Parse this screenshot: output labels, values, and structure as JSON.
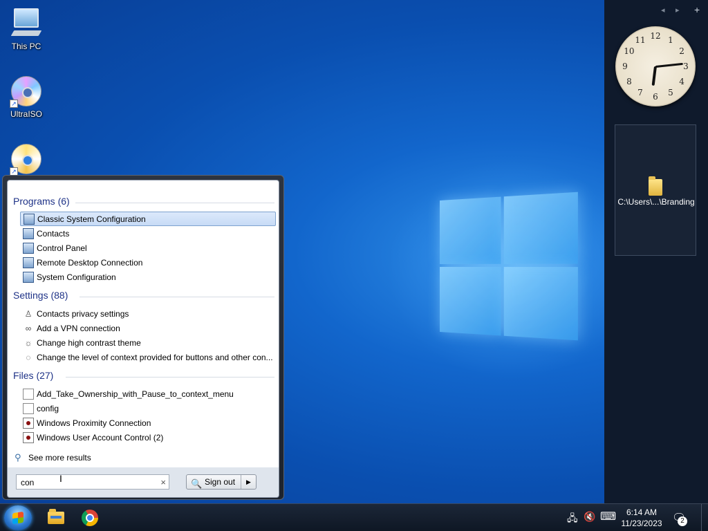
{
  "desktop": {
    "icons": [
      {
        "label": "This PC"
      },
      {
        "label": "UltraISO"
      },
      {
        "label": ""
      }
    ]
  },
  "sidebar": {
    "controls": {
      "prev": "◂",
      "next": "▸",
      "add": "+"
    },
    "clock": {
      "numerals": [
        "12",
        "1",
        "2",
        "3",
        "4",
        "5",
        "6",
        "7",
        "8",
        "9",
        "10",
        "11"
      ],
      "hour": 6,
      "minute": 14
    },
    "folder_gadget": {
      "label": "C:\\Users\\...\\Branding"
    }
  },
  "start_menu": {
    "programs": {
      "header": "Programs (6)",
      "items": [
        {
          "label": "Classic System Configuration",
          "icon": "system-config-icon",
          "selected": true
        },
        {
          "label": "Contacts",
          "icon": "contacts-icon"
        },
        {
          "label": "Control Panel",
          "icon": "control-panel-icon"
        },
        {
          "label": "Remote Desktop Connection",
          "icon": "remote-desktop-icon"
        },
        {
          "label": "System Configuration",
          "icon": "system-config-icon"
        }
      ]
    },
    "settings": {
      "header": "Settings (88)",
      "items": [
        {
          "label": "Contacts privacy settings",
          "icon": "person-icon"
        },
        {
          "label": "Add a VPN connection",
          "icon": "vpn-icon"
        },
        {
          "label": "Change high contrast theme",
          "icon": "sun-icon"
        },
        {
          "label": "Change the level of context provided for buttons and other con...",
          "icon": "narrator-icon"
        }
      ]
    },
    "files": {
      "header": "Files (27)",
      "items": [
        {
          "label": "Add_Take_Ownership_with_Pause_to_context_menu",
          "icon": "reg-file-icon"
        },
        {
          "label": "config",
          "icon": "text-file-icon"
        },
        {
          "label": "Windows Proximity Connection",
          "icon": "media-file-icon"
        },
        {
          "label": "Windows User Account Control (2)",
          "icon": "media-file-icon"
        }
      ]
    },
    "see_more": "See more results",
    "search": {
      "value": "con",
      "clear": "×"
    },
    "signout": {
      "label": "Sign out",
      "arrow": "▶"
    }
  },
  "taskbar": {
    "clock": {
      "time": "6:14 AM",
      "date": "11/23/2023"
    },
    "notifications": {
      "count": "2"
    }
  }
}
